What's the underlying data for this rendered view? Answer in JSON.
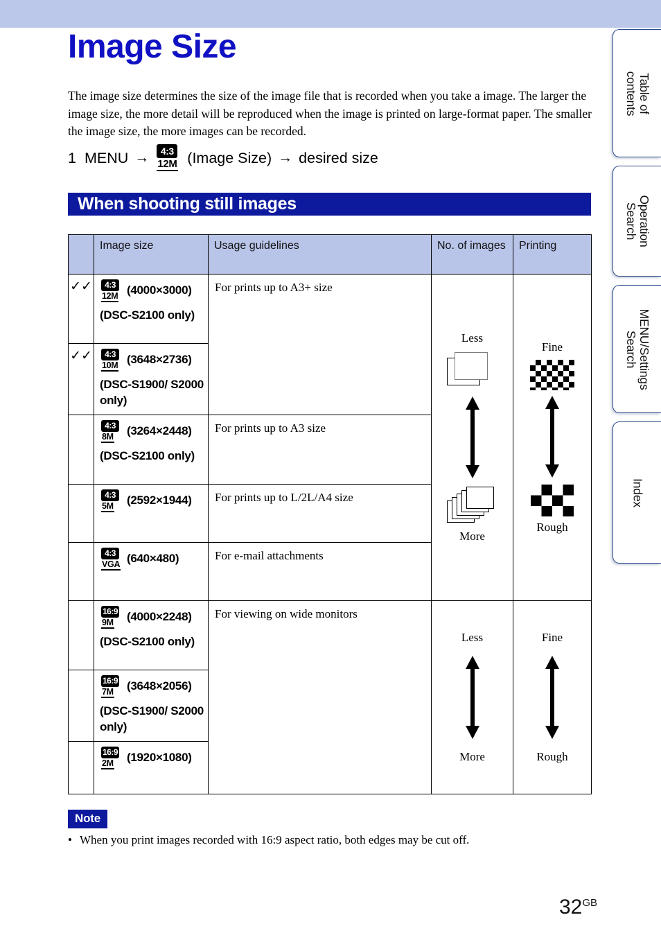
{
  "colors": {
    "band": "#bcc8ea",
    "title": "#1111c4",
    "banner": "#0d1a9e",
    "table_header": "#b8c4e8",
    "tab_border": "#2b4a8b"
  },
  "side_tabs": [
    {
      "label": "Table of\ncontents",
      "line1": "Table of",
      "line2": "contents"
    },
    {
      "label": "Operation\nSearch",
      "line1": "Operation",
      "line2": "Search"
    },
    {
      "label": "MENU/Settings\nSearch",
      "line1": "MENU/Settings",
      "line2": "Search"
    },
    {
      "label": "Index",
      "line1": "Index",
      "line2": ""
    }
  ],
  "page_title": "Image Size",
  "intro": "The image size determines the size of the image file that is recorded when you take a image. The larger the image size, the more detail will be reproduced when the image is printed on large-format paper. The smaller the image size, the more images can be recorded.",
  "step": {
    "number": "1",
    "menu": "MENU",
    "arrow": "→",
    "icon_ratio": "4:3",
    "icon_sub": "12M",
    "icon_label": "(Image Size)",
    "target": "desired size"
  },
  "section_banner": "When shooting still images",
  "table": {
    "headers": [
      "",
      "Image size",
      "Usage guidelines",
      "No. of images",
      "Printing"
    ],
    "rows": [
      {
        "check": "✓✓",
        "ratio": "4:3",
        "mp": "12M",
        "dimensions": "(4000×3000)",
        "only": "(DSC-S2100 only)",
        "usage": "For prints up to A3+ size"
      },
      {
        "check": "✓✓",
        "ratio": "4:3",
        "mp": "10M",
        "dimensions": "(3648×2736)",
        "only": "(DSC-S1900/ S2000 only)",
        "usage": ""
      },
      {
        "check": "",
        "ratio": "4:3",
        "mp": "8M",
        "dimensions": "(3264×2448)",
        "only": "(DSC-S2100 only)",
        "usage": "For prints up to A3 size"
      },
      {
        "check": "",
        "ratio": "4:3",
        "mp": "5M",
        "dimensions": "(2592×1944)",
        "only": "",
        "usage": "For prints up to L/2L/A4 size"
      },
      {
        "check": "",
        "ratio": "4:3",
        "mp": "VGA",
        "dimensions": "(640×480)",
        "only": "",
        "usage": "For e-mail attachments"
      },
      {
        "check": "",
        "ratio": "16:9",
        "mp": "9M",
        "dimensions": "(4000×2248)",
        "only": "(DSC-S2100 only)",
        "usage": "For viewing on wide monitors"
      },
      {
        "check": "",
        "ratio": "16:9",
        "mp": "7M",
        "dimensions": "(3648×2056)",
        "only": "(DSC-S1900/ S2000 only)",
        "usage": ""
      },
      {
        "check": "",
        "ratio": "16:9",
        "mp": "2M",
        "dimensions": "(1920×1080)",
        "only": "",
        "usage": ""
      }
    ],
    "meters": {
      "group_43": {
        "num_top": "Less",
        "num_bottom": "More",
        "print_top": "Fine",
        "print_bottom": "Rough"
      },
      "group_169": {
        "num_top": "Less",
        "num_bottom": "More",
        "print_top": "Fine",
        "print_bottom": "Rough"
      }
    }
  },
  "note": {
    "badge": "Note",
    "bullet": "•",
    "text": "When you print images recorded with 16:9 aspect ratio, both edges may be cut off."
  },
  "footer": {
    "page_number": "32",
    "suffix": "GB"
  }
}
